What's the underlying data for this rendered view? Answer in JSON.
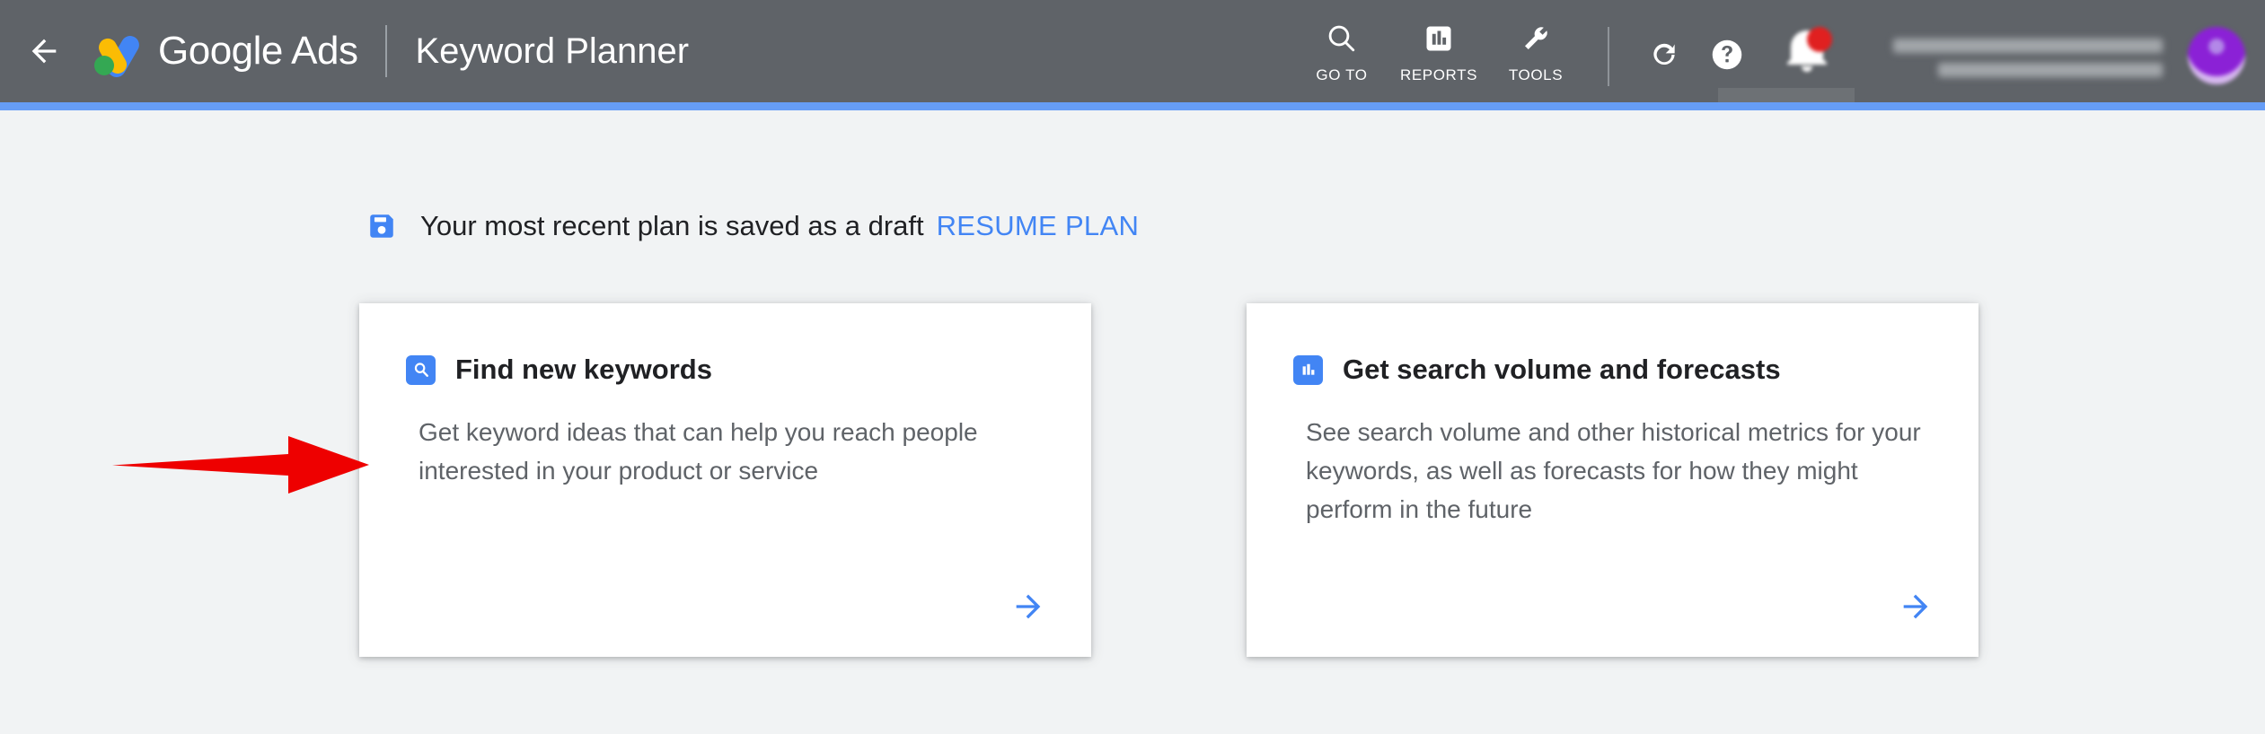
{
  "header": {
    "back_icon": "arrow-left-icon",
    "brand": "Google Ads",
    "page_title": "Keyword Planner",
    "tools": [
      {
        "label": "GO TO",
        "icon": "search-icon"
      },
      {
        "label": "REPORTS",
        "icon": "bar-chart-icon"
      },
      {
        "label": "TOOLS",
        "icon": "wrench-icon"
      }
    ],
    "actions": [
      {
        "name": "refresh-icon"
      },
      {
        "name": "help-icon"
      },
      {
        "name": "notifications-icon"
      }
    ],
    "account": {
      "line1": "",
      "line2": "",
      "avatar_label": ""
    },
    "colors": {
      "bar": "#5f6368",
      "accent_line": "#669df6",
      "logo_blue": "#4285f4",
      "logo_yellow": "#fbbc04",
      "logo_green": "#34a853"
    }
  },
  "banner": {
    "icon": "save-draft-icon",
    "message": "Your most recent plan is saved as a draft",
    "action_label": "RESUME PLAN",
    "action_color": "#4285f4"
  },
  "cards": [
    {
      "id": "find-new-keywords",
      "icon": "search-icon",
      "title": "Find new keywords",
      "description": "Get keyword ideas that can help you reach people interested in your product or service",
      "arrow_icon": "arrow-right-icon"
    },
    {
      "id": "get-search-volume-and-forecasts",
      "icon": "bar-chart-icon",
      "title": "Get search volume and forecasts",
      "description": "See search volume and other historical metrics for your keywords, as well as forecasts for how they might perform in the future",
      "arrow_icon": "arrow-right-icon"
    }
  ],
  "annotation": {
    "name": "red-pointer-arrow",
    "color": "#ee0000",
    "points_at": "find-new-keywords"
  },
  "page": {
    "background": "#f1f3f4"
  }
}
